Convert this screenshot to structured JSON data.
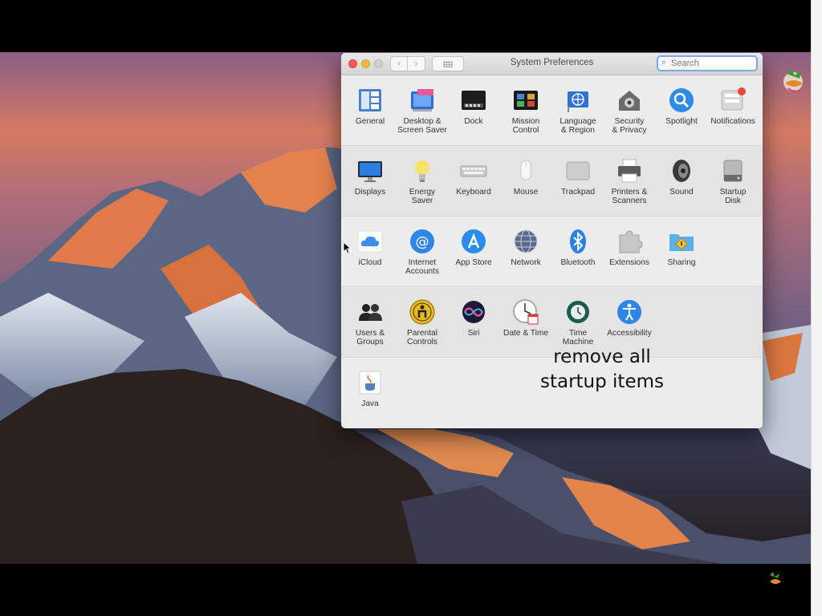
{
  "window": {
    "title": "System Preferences",
    "search_placeholder": "Search",
    "search_value": ""
  },
  "sections": [
    {
      "panes": [
        {
          "id": "general",
          "label": "General"
        },
        {
          "id": "desktop",
          "label": "Desktop &\nScreen Saver"
        },
        {
          "id": "dock",
          "label": "Dock"
        },
        {
          "id": "mission",
          "label": "Mission\nControl"
        },
        {
          "id": "language",
          "label": "Language\n& Region"
        },
        {
          "id": "security",
          "label": "Security\n& Privacy"
        },
        {
          "id": "spotlight",
          "label": "Spotlight"
        },
        {
          "id": "notifications",
          "label": "Notifications"
        }
      ]
    },
    {
      "panes": [
        {
          "id": "displays",
          "label": "Displays"
        },
        {
          "id": "energy",
          "label": "Energy\nSaver"
        },
        {
          "id": "keyboard",
          "label": "Keyboard"
        },
        {
          "id": "mouse",
          "label": "Mouse"
        },
        {
          "id": "trackpad",
          "label": "Trackpad"
        },
        {
          "id": "printers",
          "label": "Printers &\nScanners"
        },
        {
          "id": "sound",
          "label": "Sound"
        },
        {
          "id": "startup",
          "label": "Startup\nDisk"
        }
      ]
    },
    {
      "panes": [
        {
          "id": "icloud",
          "label": "iCloud"
        },
        {
          "id": "internet",
          "label": "Internet\nAccounts"
        },
        {
          "id": "appstore",
          "label": "App Store"
        },
        {
          "id": "network",
          "label": "Network"
        },
        {
          "id": "bluetooth",
          "label": "Bluetooth"
        },
        {
          "id": "extensions",
          "label": "Extensions"
        },
        {
          "id": "sharing",
          "label": "Sharing"
        }
      ]
    },
    {
      "panes": [
        {
          "id": "users",
          "label": "Users &\nGroups"
        },
        {
          "id": "parental",
          "label": "Parental\nControls"
        },
        {
          "id": "siri",
          "label": "Siri"
        },
        {
          "id": "datetime",
          "label": "Date & Time"
        },
        {
          "id": "timemachine",
          "label": "Time\nMachine"
        },
        {
          "id": "accessibility",
          "label": "Accessibility"
        }
      ]
    },
    {
      "panes": [
        {
          "id": "java",
          "label": "Java"
        }
      ]
    }
  ],
  "overlay": {
    "line1": "remove all",
    "line2": "startup items"
  },
  "colors": {
    "close": "#fc5b57",
    "minimize": "#e5bf3c",
    "accent": "#2f8ae5",
    "notification_badge": "#f2453d"
  }
}
